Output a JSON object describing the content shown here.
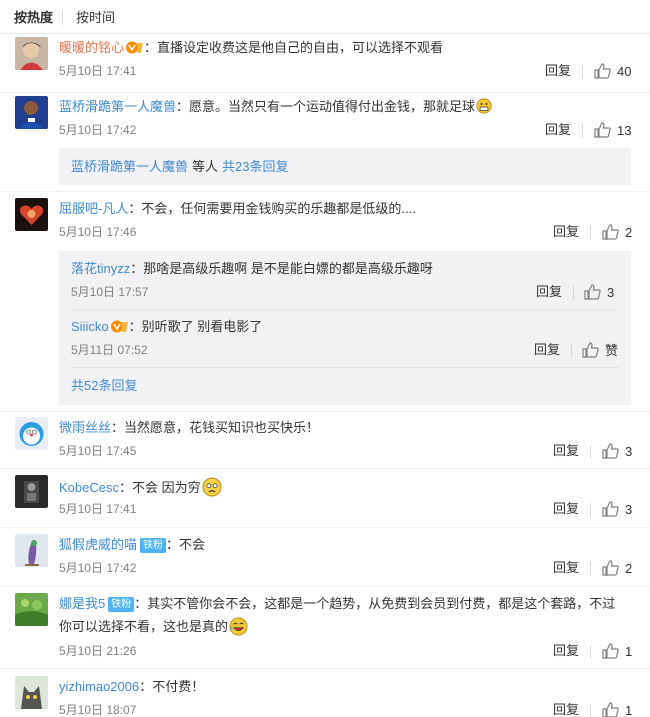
{
  "sort": {
    "hot": "按热度",
    "time": "按时间"
  },
  "comments": [
    {
      "user": "暖暖的铭心",
      "text": "直播设定收费这是他自己的自由，可以选择不观看",
      "time": "5月10日 17:41",
      "reply": "回复",
      "likes": "40"
    },
    {
      "user": "蓝桥滑跪第一人魔兽",
      "text": "愿意。当然只有一个运动值得付出金钱，那就足球",
      "time": "5月10日 17:42",
      "reply": "回复",
      "likes": "13",
      "more": {
        "who": "蓝桥滑跪第一人魔兽",
        "deng": "等人",
        "count": "共23条回复"
      }
    },
    {
      "user": "屈服吧-凡人",
      "text": "不会，任何需要用金钱购买的乐趣都是低级的....",
      "time": "5月10日 17:46",
      "reply": "回复",
      "likes": "2",
      "replies": [
        {
          "user": "落花tinyzz",
          "text": "那啥是高级乐趣啊 是不是能白嫖的都是高级乐趣呀",
          "time": "5月10日 17:57",
          "reply": "回复",
          "likes": "3"
        },
        {
          "user": "Siiicko",
          "text": "别听歌了 别看电影了",
          "time": "5月11日 07:52",
          "reply": "回复",
          "likes": "赞"
        }
      ],
      "more": {
        "count": "共52条回复"
      }
    },
    {
      "user": "微雨丝丝",
      "text": "当然愿意，花钱买知识也买快乐！",
      "time": "5月10日 17:45",
      "reply": "回复",
      "likes": "3"
    },
    {
      "user": "KobeCesc",
      "text": "不会 因为穷",
      "time": "5月10日 17:41",
      "reply": "回复",
      "likes": "3"
    },
    {
      "user": "狐假虎威的喵",
      "badge": "铁粉",
      "text": "不会",
      "time": "5月10日 17:42",
      "reply": "回复",
      "likes": "2"
    },
    {
      "user": "娜是我5",
      "badge": "铁粉",
      "text": "其实不管你会不会，这都是一个趋势，从免费到会员到付费，都是这个套路，不过",
      "text2": "你可以选择不看，这也是真的",
      "time": "5月10日 21:26",
      "reply": "回复",
      "likes": "1"
    },
    {
      "user": "yizhimao2006",
      "text": "不付费！",
      "time": "5月10日 18:07",
      "reply": "回复",
      "likes": "1"
    }
  ],
  "colon": "：",
  "icons": {
    "like": "thumbs-up-icon",
    "vip": "vip-badge-icon"
  },
  "colors": {
    "username": "#eb7350",
    "link": "#3d8bd1",
    "meta": "#808080",
    "reply_bg": "#f2f2f5"
  }
}
